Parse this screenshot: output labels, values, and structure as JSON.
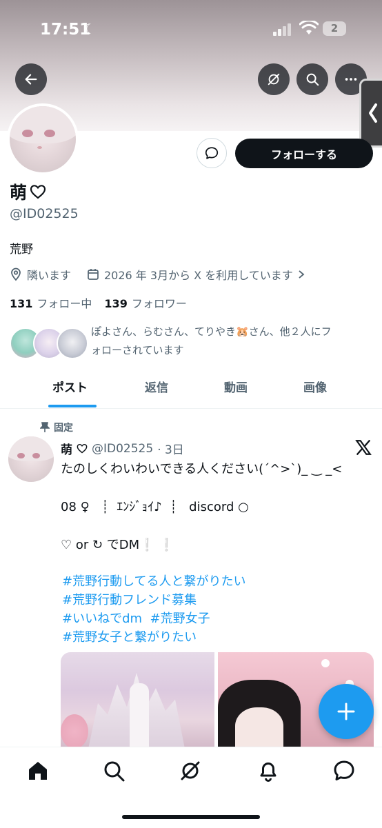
{
  "status_bar": {
    "time": "17:51",
    "battery": "2"
  },
  "profile": {
    "name": "萌",
    "handle": "@ID02525",
    "bio": "荒野",
    "location": "隣います",
    "joined": "2026 年 3月から X を利用しています",
    "following_count": "131",
    "following_label": "フォロー中",
    "followers_count": "139",
    "followers_label": "フォロワー",
    "followed_by_line1": "ぽよさん、らむさん、てりやき🐹さん、他２人にフ",
    "followed_by_line2": "ォローされています",
    "follow_button": "フォローする"
  },
  "tabs": [
    {
      "label": "ポスト"
    },
    {
      "label": "返信"
    },
    {
      "label": "動画"
    },
    {
      "label": "画像"
    }
  ],
  "post": {
    "pinned_label": "固定",
    "author_name": "萌",
    "author_handle": "@ID02525",
    "time": "· 3日",
    "line1": "たのしくわいわいできる人ください(ˊ^>ˋ)_ ‿ _<",
    "line2": "08 ♀   ┊  ｴﾝｼﾞｮｲ♪  ┊   discord ○",
    "line3": "♡ or ↻ でDM❕ ❕",
    "hashtags": [
      "#荒野行動してる人と繋がりたい",
      "#荒野行動フレンド募集",
      "#いいねでdm  #荒野女子",
      "#荒野女子と繋がりたい"
    ]
  },
  "colors": {
    "accent": "#1d9bf0",
    "text": "#0f1419",
    "secondary": "#536471"
  }
}
